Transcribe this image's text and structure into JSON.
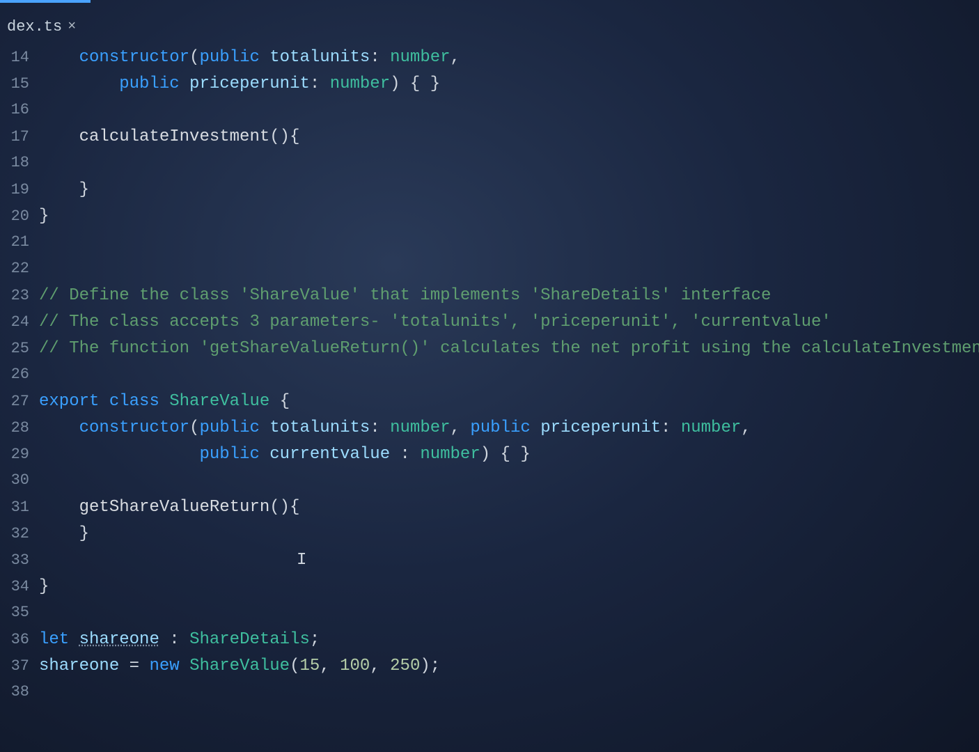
{
  "tab": {
    "name": "dex.ts",
    "close": "×"
  },
  "lines": {
    "start": 14,
    "end": 38
  },
  "code": {
    "l14": {
      "indent": "    ",
      "kw_constructor": "constructor",
      "p1": "(",
      "kw_public1": "public",
      "sp1": " ",
      "id1": "totalunits",
      "colon1": ": ",
      "type1": "number",
      "comma1": ","
    },
    "l15": {
      "indent": "        ",
      "kw_public": "public",
      "sp": " ",
      "id": "priceperunit",
      "colon": ": ",
      "type": "number",
      "tail": ") { }"
    },
    "l16": {
      "text": ""
    },
    "l17": {
      "indent": "    ",
      "fn": "calculateInvestment",
      "tail": "(){"
    },
    "l18": {
      "text": ""
    },
    "l19": {
      "indent": "    ",
      "brace": "}"
    },
    "l20": {
      "brace": "}"
    },
    "l21": {
      "text": ""
    },
    "l22": {
      "text": ""
    },
    "l23": {
      "cm": "// Define the class 'ShareValue' that implements 'ShareDetails' interface"
    },
    "l24": {
      "cm": "// The class accepts 3 parameters- 'totalunits', 'priceperunit', 'currentvalue'"
    },
    "l25": {
      "cm": "// The function 'getShareValueReturn()' calculates the net profit using the calculateInvestmen"
    },
    "l26": {
      "text": ""
    },
    "l27": {
      "kw_export": "export",
      "sp1": " ",
      "kw_class": "class",
      "sp2": " ",
      "type": "ShareValue",
      "sp3": " ",
      "brace": "{"
    },
    "l28": {
      "indent": "    ",
      "kw_constructor": "constructor",
      "p1": "(",
      "kw_public1": "public",
      "sp1": " ",
      "id1": "totalunits",
      "colon1": ": ",
      "type1": "number",
      "comma1": ", ",
      "kw_public2": "public",
      "sp2": " ",
      "id2": "priceperunit",
      "colon2": ": ",
      "type2": "number",
      "comma2": ","
    },
    "l29": {
      "indent": "                ",
      "kw_public": "public",
      "sp": " ",
      "id": "currentvalue",
      "sp2": " ",
      "colon": ": ",
      "type": "number",
      "tail": ") { }"
    },
    "l30": {
      "text": ""
    },
    "l31": {
      "indent": "    ",
      "fn": "getShareValueReturn",
      "tail": "(){"
    },
    "l32": {
      "indent": "    ",
      "brace": "}"
    },
    "l33": {
      "text": ""
    },
    "l34": {
      "brace": "}"
    },
    "l35": {
      "text": ""
    },
    "l36": {
      "kw_let": "let",
      "sp1": " ",
      "id": "shareone",
      "sp2": " ",
      "colon": ": ",
      "type": "ShareDetails",
      "semi": ";"
    },
    "l37": {
      "id": "shareone",
      "sp1": " ",
      "eq": "=",
      "sp2": " ",
      "kw_new": "new",
      "sp3": " ",
      "type": "ShareValue",
      "p1": "(",
      "n1": "15",
      "c1": ", ",
      "n2": "100",
      "c2": ", ",
      "n3": "250",
      "tail": ");"
    },
    "l38": {
      "text": ""
    }
  },
  "caret": "I"
}
